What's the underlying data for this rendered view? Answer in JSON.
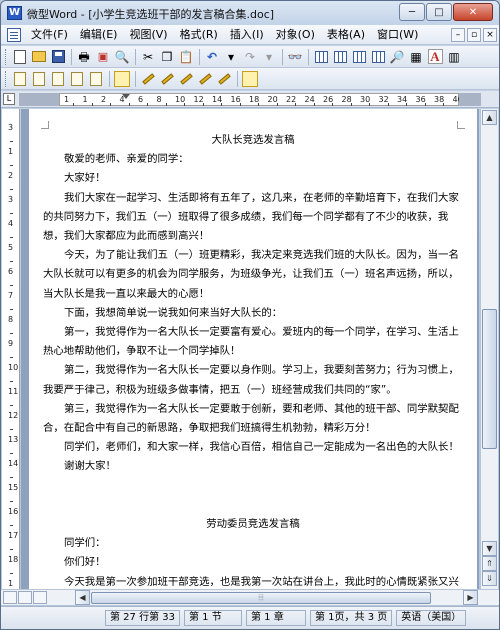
{
  "window": {
    "title": "微型Word - [小学生竞选班干部的发言稿合集.doc]",
    "app_icon": "W"
  },
  "menu": {
    "items": [
      "文件(F)",
      "编辑(E)",
      "视图(V)",
      "格式(R)",
      "插入(I)",
      "对象(O)",
      "表格(A)",
      "窗口(W)"
    ]
  },
  "toolbar1": {
    "icons": [
      "new-doc-icon",
      "open-folder-icon",
      "save-icon",
      "print-icon",
      "pdf-icon",
      "print-preview-icon",
      "cut-icon",
      "copy-icon",
      "paste-icon",
      "undo-icon",
      "redo-icon",
      "find-icon",
      "insert-table-icon",
      "insert-column-icon",
      "table-grid-icon",
      "grid-icon",
      "zoom-icon",
      "chart-icon",
      "font-color-icon",
      "column-icon"
    ]
  },
  "document": {
    "paragraphs": [
      {
        "type": "title",
        "text": "大队长竞选发言稿"
      },
      {
        "type": "indent",
        "text": "敬爱的老师、亲爱的同学："
      },
      {
        "type": "indent",
        "text": "大家好！"
      },
      {
        "type": "indent",
        "text": "我们大家在一起学习、生活即将有五年了，这几来，在老师的辛勤培育下，在我们大家的共同努力下，我们五（一）班取得了很多成绩，我们每一个同学都有了不少的收获，我想，我们大家都应为此而感到高兴！"
      },
      {
        "type": "indent",
        "text": "今天，为了能让我们五（一）班更精彩，我决定来竞选我们班的大队长。因为，当一名大队长就可以有更多的机会为同学服务，为班级争光，让我们五（一）班名声远扬，所以，当大队长是我一直以来最大的心愿！"
      },
      {
        "type": "indent",
        "text": "下面，我想简单说一说我如何来当好大队长的："
      },
      {
        "type": "indent",
        "text": "第一，我觉得作为一名大队长一定要富有爱心。爱班内的每一个同学，在学习、生活上热心地帮助他们，争取不让一个同学掉队！"
      },
      {
        "type": "indent",
        "text": "第二，我觉得作为一名大队长一定要以身作则。学习上，我要刻苦努力；行为习惯上，我要严于律己，积极为班级多做事情，把五（一）班经营成我们共同的“家”。"
      },
      {
        "type": "indent",
        "text": "第三，我觉得作为一名大队长一定要敢于创新，要和老师、其他的班干部、同学默契配合，在配合中有自己的新思路，争取把我们班搞得生机勃勃，精彩万分！"
      },
      {
        "type": "indent",
        "text": "同学们，老师们，和大家一样，我信心百倍，相信自己一定能成为一名出色的大队长！"
      },
      {
        "type": "indent",
        "text": "谢谢大家！"
      },
      {
        "type": "blank",
        "text": ""
      },
      {
        "type": "blank",
        "text": ""
      },
      {
        "type": "title",
        "text": "劳动委员竞选发言稿"
      },
      {
        "type": "indent",
        "text": "同学们："
      },
      {
        "type": "indent",
        "text": "你们好！"
      },
      {
        "type": "indent",
        "text": "今天我是第一次参加班干部竞选，也是我第一次站在讲台上，我此时的心情既紧张又兴奋。或许你们会很惊讶，我竞选的岗位竟然是卫生委员。有的同学可能会暗自发笑：劳"
      }
    ]
  },
  "ruler": {
    "labels": [
      "1",
      "1",
      "2",
      "4",
      "6",
      "8",
      "10",
      "12",
      "14",
      "16",
      "18",
      "20",
      "22",
      "24",
      "26",
      "28",
      "30",
      "32",
      "34",
      "36",
      "38",
      "40"
    ]
  },
  "vruler": {
    "labels": [
      "3",
      "1",
      "2",
      "3",
      "4",
      "5",
      "6",
      "7",
      "8",
      "9",
      "10",
      "11",
      "12",
      "13",
      "14",
      "15",
      "16",
      "17",
      "18",
      "1"
    ]
  },
  "statusbar": {
    "cells": [
      "第 27 行第 33",
      "第 1 节",
      "第 1 章",
      "第 1页，共 3 页",
      "英语（美国）"
    ]
  }
}
